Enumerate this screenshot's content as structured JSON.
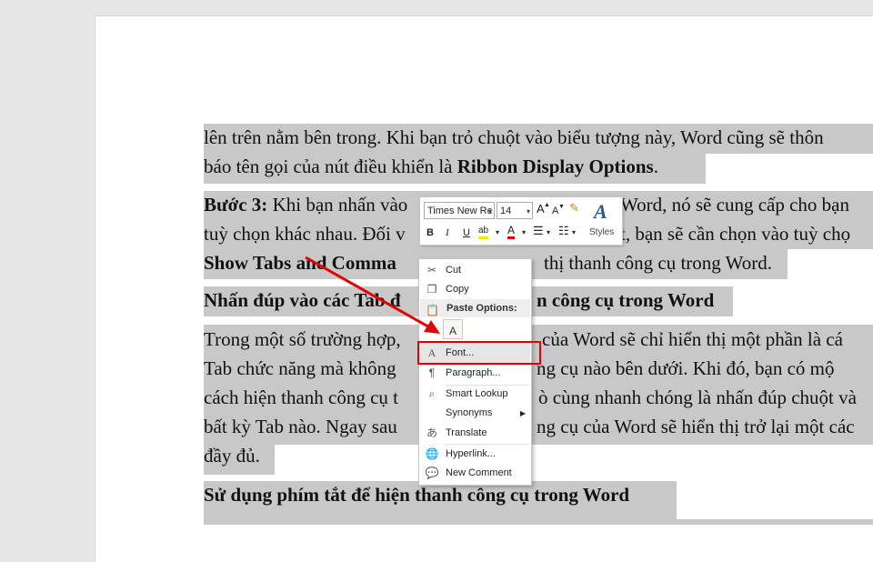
{
  "document": {
    "lines": [
      {
        "parts": [
          "lên trên nằm bên trong. Khi bạn trỏ chuột vào biểu tượng này, Word cũng sẽ thôn"
        ]
      },
      {
        "parts": [
          "báo tên gọi của nút điều khiển là ",
          "Ribbon Display Options",
          "."
        ]
      },
      {
        "parts": [
          "Bước 3:",
          " Khi bạn nhấn vào",
          "Word, nó sẽ cung cấp cho bạn"
        ]
      },
      {
        "parts": [
          "tuỳ chọn khác nhau. Đối v",
          "t, bạn sẽ cần chọn vào tuỳ chọ"
        ]
      },
      {
        "parts": [
          "Show Tabs and Comma",
          "thị thanh công cụ trong Word."
        ]
      },
      {
        "parts": [
          "Nhấn đúp vào các Tab đ",
          "n công cụ trong Word"
        ]
      },
      {
        "parts": [
          "Trong một số trường hợp,",
          "của Word sẽ chỉ hiển thị một phần là cá"
        ]
      },
      {
        "parts": [
          "Tab chức năng mà không",
          "ng cụ nào bên dưới. Khi đó, bạn có mộ"
        ]
      },
      {
        "parts": [
          "cách hiện thanh công cụ t",
          "ò cùng nhanh chóng là nhấn đúp chuột và"
        ]
      },
      {
        "parts": [
          "bất kỳ Tab nào. Ngay sau",
          "ng cụ của Word sẽ hiển thị trở lại một các"
        ]
      },
      {
        "parts": [
          "đầy đủ."
        ]
      },
      {
        "parts": [
          "Sử dụng phím tắt để hiện thanh công cụ trong Word"
        ]
      }
    ]
  },
  "mini_toolbar": {
    "font_name": "Times New Rc",
    "font_size": "14",
    "grow_font": "A",
    "shrink_font": "A",
    "bold": "B",
    "italic": "I",
    "underline": "U",
    "highlight": "ab",
    "font_color": "A",
    "styles_icon": "A",
    "styles_label": "Styles"
  },
  "context_menu": {
    "cut": "Cut",
    "copy": "Copy",
    "paste_options": "Paste Options:",
    "paste_glyph": "A",
    "font": "Font...",
    "paragraph": "Paragraph...",
    "smart_lookup": "Smart Lookup",
    "synonyms": "Synonyms",
    "translate": "Translate",
    "hyperlink": "Hyperlink...",
    "new_comment": "New Comment"
  },
  "colors": {
    "selection": "#c8c8c8",
    "annotation_red": "#e00000",
    "word_blue": "#2b579a"
  }
}
